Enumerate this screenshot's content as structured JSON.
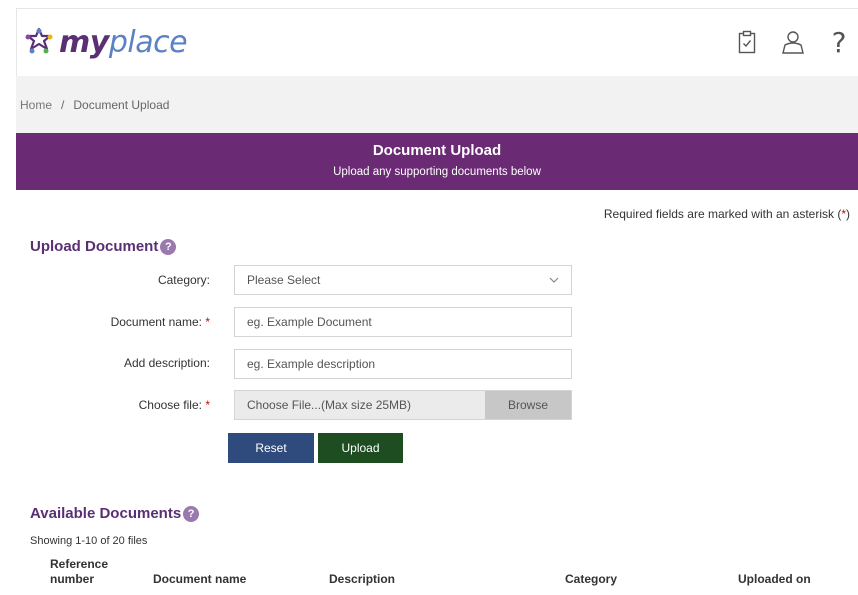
{
  "header": {
    "logo_my": "my",
    "logo_place": "place",
    "icons": [
      "clipboard-check-icon",
      "user-icon",
      "help-icon"
    ],
    "help_glyph": "?"
  },
  "breadcrumb": {
    "home": "Home",
    "separator": "/",
    "current": "Document Upload"
  },
  "banner": {
    "title": "Document Upload",
    "subtitle": "Upload any supporting documents below",
    "color": "#6b2a74"
  },
  "required_note": {
    "text": "Required fields are marked with an asterisk (",
    "asterisk": "*",
    "close": ")"
  },
  "upload_section": {
    "title": "Upload Document",
    "help": "?",
    "category_label": "Category:",
    "category_value": "Please Select",
    "docname_label": "Document name:",
    "docname_placeholder": "eg. Example Document",
    "description_label": "Add description:",
    "description_placeholder": "eg. Example description",
    "file_label": "Choose file:",
    "file_placeholder": "Choose File...(Max size 25MB)",
    "browse_label": "Browse",
    "asterisk": "*",
    "reset_label": "Reset",
    "upload_label": "Upload"
  },
  "documents_section": {
    "title": "Available Documents",
    "help": "?",
    "showing": "Showing 1-10 of 20 files",
    "columns": [
      "Reference number",
      "Document name",
      "Description",
      "Category",
      "Uploaded on"
    ],
    "col_ref_line1": "Reference",
    "col_ref_line2": "number"
  },
  "colors": {
    "brand_purple": "#5a2f74",
    "reset_blue": "#2f4a7d",
    "upload_green": "#1f4d22"
  }
}
